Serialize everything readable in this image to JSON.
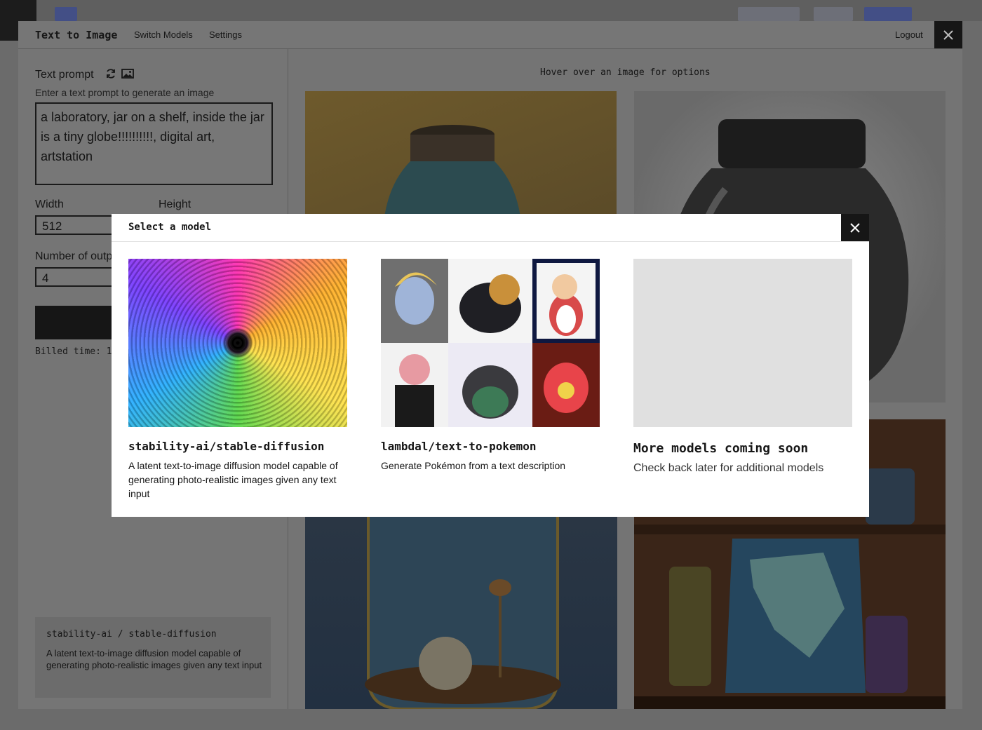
{
  "app": {
    "title": "Text to Image",
    "nav": [
      "Switch Models",
      "Settings"
    ],
    "logout_label": "Logout"
  },
  "form": {
    "prompt_label": "Text prompt",
    "prompt_hint": "Enter a text prompt to generate an image",
    "prompt_value": "a laboratory, jar on a shelf, inside the jar is a tiny globe!!!!!!!!!!, digital art, artstation",
    "width_label": "Width",
    "width_value": "512",
    "height_label": "Height",
    "outputs_label": "Number of outputs",
    "outputs_value": "4",
    "billed_text": "Billed time: 1"
  },
  "selected_model": {
    "name": "stability-ai / stable-diffusion",
    "description": "A latent text-to-image diffusion model capable of generating photo-realistic images given any text input"
  },
  "gallery": {
    "hint": "Hover over an image for options"
  },
  "modal": {
    "title": "Select a model",
    "models": [
      {
        "name": "stability-ai/stable-diffusion",
        "description": "A latent text-to-image diffusion model capable of generating photo-realistic images given any text input"
      },
      {
        "name": "lambdal/text-to-pokemon",
        "description": "Generate Pokémon from a text description"
      },
      {
        "name": "More models coming soon",
        "description": "Check back later for additional models"
      }
    ]
  },
  "colors": {
    "accent": "#161616",
    "overlay": "#747474",
    "placeholder_tile": "#e0e0e0"
  }
}
